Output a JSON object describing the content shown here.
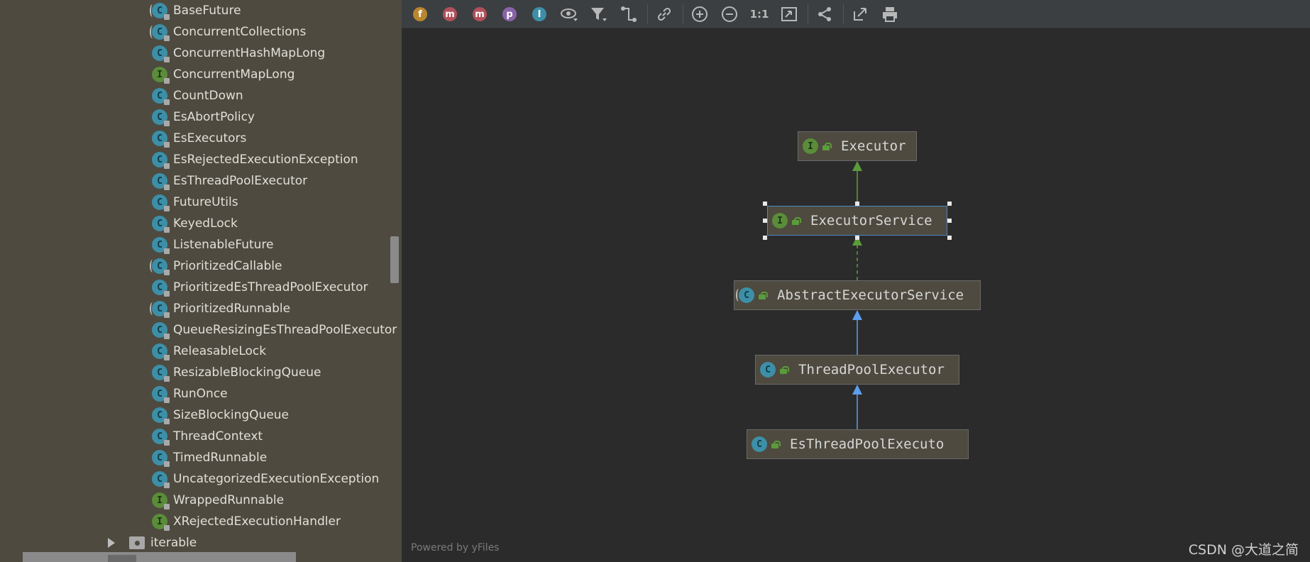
{
  "tree": {
    "items": [
      {
        "label": "BaseFuture",
        "kind": "abstract"
      },
      {
        "label": "ConcurrentCollections",
        "kind": "abstract"
      },
      {
        "label": "ConcurrentHashMapLong",
        "kind": "class"
      },
      {
        "label": "ConcurrentMapLong",
        "kind": "interface"
      },
      {
        "label": "CountDown",
        "kind": "class"
      },
      {
        "label": "EsAbortPolicy",
        "kind": "class"
      },
      {
        "label": "EsExecutors",
        "kind": "class"
      },
      {
        "label": "EsRejectedExecutionException",
        "kind": "class"
      },
      {
        "label": "EsThreadPoolExecutor",
        "kind": "class"
      },
      {
        "label": "FutureUtils",
        "kind": "class"
      },
      {
        "label": "KeyedLock",
        "kind": "class"
      },
      {
        "label": "ListenableFuture",
        "kind": "class"
      },
      {
        "label": "PrioritizedCallable",
        "kind": "abstract"
      },
      {
        "label": "PrioritizedEsThreadPoolExecutor",
        "kind": "class"
      },
      {
        "label": "PrioritizedRunnable",
        "kind": "abstract"
      },
      {
        "label": "QueueResizingEsThreadPoolExecutor",
        "kind": "class"
      },
      {
        "label": "ReleasableLock",
        "kind": "class"
      },
      {
        "label": "ResizableBlockingQueue",
        "kind": "class"
      },
      {
        "label": "RunOnce",
        "kind": "class"
      },
      {
        "label": "SizeBlockingQueue",
        "kind": "class"
      },
      {
        "label": "ThreadContext",
        "kind": "class"
      },
      {
        "label": "TimedRunnable",
        "kind": "class"
      },
      {
        "label": "UncategorizedExecutionException",
        "kind": "class"
      },
      {
        "label": "WrappedRunnable",
        "kind": "interface"
      },
      {
        "label": "XRejectedExecutionHandler",
        "kind": "interface"
      }
    ],
    "package_label": "iterable"
  },
  "toolbar": {
    "fields_icon": "f",
    "methods_icon": "m",
    "properties_icon": "p",
    "inner_icon": "I",
    "zoom_actual": "1:1"
  },
  "diagram": {
    "nodes": [
      {
        "id": "executor",
        "label": "Executor",
        "kind": "interface",
        "icon_letter": "I"
      },
      {
        "id": "executorservice",
        "label": "ExecutorService",
        "kind": "interface",
        "icon_letter": "I"
      },
      {
        "id": "abstractexecutorservice",
        "label": "AbstractExecutorService",
        "kind": "abstract",
        "icon_letter": "C"
      },
      {
        "id": "threadpoolexecutor",
        "label": "ThreadPoolExecutor",
        "kind": "class",
        "icon_letter": "C"
      },
      {
        "id": "esthreadpoolexecutor",
        "label": "EsThreadPoolExecuto",
        "kind": "class",
        "icon_letter": "C"
      }
    ],
    "edges": [
      {
        "from": "executorservice",
        "to": "executor",
        "type": "extends-interface"
      },
      {
        "from": "abstractexecutorservice",
        "to": "executorservice",
        "type": "implements"
      },
      {
        "from": "threadpoolexecutor",
        "to": "abstractexecutorservice",
        "type": "extends"
      },
      {
        "from": "esthreadpoolexecutor",
        "to": "threadpoolexecutor",
        "type": "extends"
      }
    ],
    "selected": "executorservice"
  },
  "footer": {
    "powered_by": "Powered by yFiles",
    "watermark": "CSDN @大道之简"
  },
  "colors": {
    "tree_bg": "#4e4a3f",
    "diagram_bg": "#2b2b2b",
    "class_icon": "#3d8fa7",
    "interface_icon": "#5a8c3a",
    "selection": "#4a88c7",
    "extends_arrow": "#5c9ef0",
    "interface_arrow": "#5a9c3a"
  }
}
